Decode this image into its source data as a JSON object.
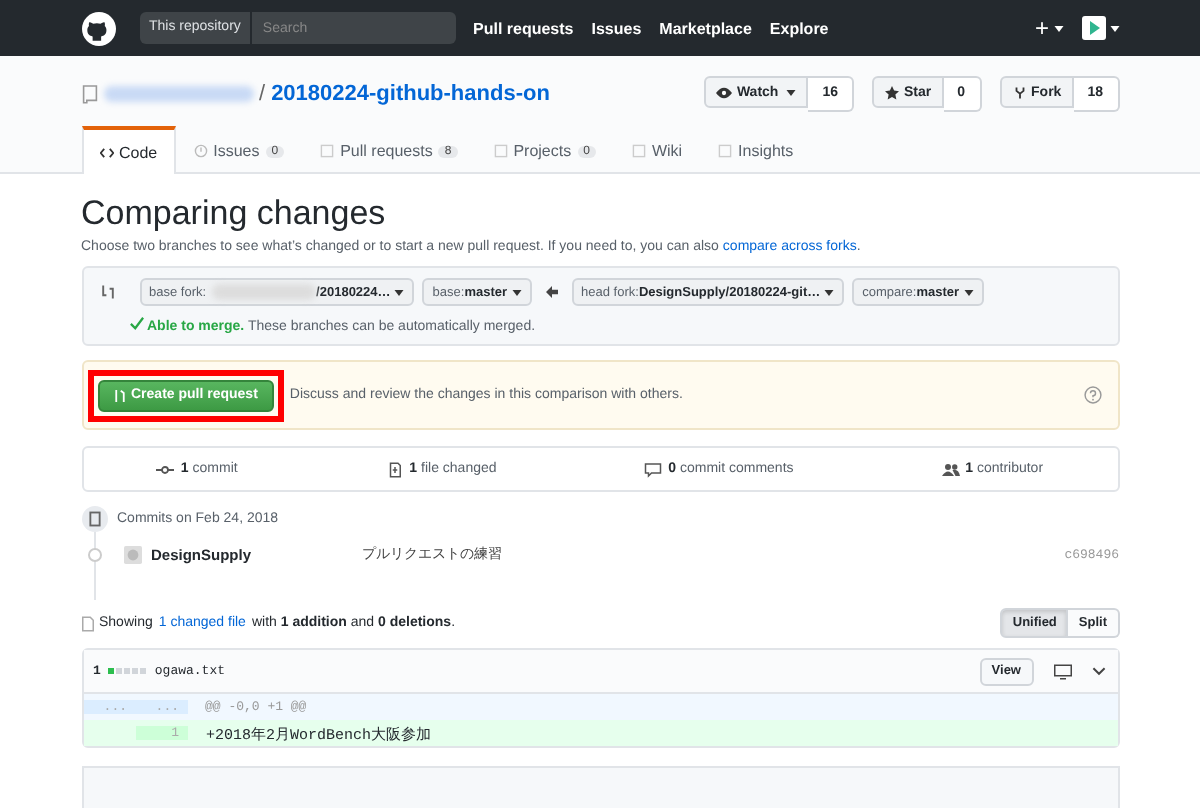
{
  "header": {
    "scope": "This repository",
    "search": {
      "placeholder": "Search"
    },
    "nav": [
      "Pull requests",
      "Issues",
      "Marketplace",
      "Explore"
    ],
    "plus": "+"
  },
  "repo": {
    "separator": "/",
    "name": "20180224-github-hands-on",
    "actions": [
      {
        "kind": "watch",
        "label": "Watch",
        "count": "16"
      },
      {
        "kind": "star",
        "label": "Star",
        "count": "0"
      },
      {
        "kind": "fork",
        "label": "Fork",
        "count": "18"
      }
    ]
  },
  "tabs": [
    {
      "kind": "code",
      "label": "Code",
      "selected": true
    },
    {
      "kind": "issues",
      "label": "Issues",
      "count": "0",
      "selected": false
    },
    {
      "kind": "pulls",
      "label": "Pull requests",
      "count": "8",
      "selected": false
    },
    {
      "kind": "projects",
      "label": "Projects",
      "count": "0",
      "selected": false
    },
    {
      "kind": "wiki",
      "label": "Wiki",
      "selected": false
    },
    {
      "kind": "insights",
      "label": "Insights",
      "selected": false
    }
  ],
  "title": "Comparing changes",
  "description": {
    "text": "Choose two branches to see what’s changed or to start a new pull request. If you need to, you can also",
    "link": "compare across forks",
    "end": "."
  },
  "compare": {
    "selectors": [
      {
        "label": "base fork:",
        "blurred": true,
        "value": "/20180224…"
      },
      {
        "label": "base:",
        "value": "master"
      },
      {
        "label": "head fork:",
        "value": "DesignSupply/20180224-git…"
      },
      {
        "label": "compare:",
        "value": "master"
      }
    ],
    "merge": {
      "ok": true,
      "status": "Able to merge.",
      "text": "These branches can be automatically merged."
    }
  },
  "create": {
    "label": "Create pull request",
    "highlighted": true,
    "text": "Discuss and review the changes in this comparison with others."
  },
  "stats": [
    {
      "kind": "commit",
      "count": "1",
      "label": "commit"
    },
    {
      "kind": "file",
      "count": "1",
      "label": "file changed"
    },
    {
      "kind": "comment",
      "count": "0",
      "label": "commit comments"
    },
    {
      "kind": "people",
      "count": "1",
      "label": "contributor"
    }
  ],
  "commits": {
    "date": "Commits on Feb 24, 2018",
    "items": [
      {
        "author": "DesignSupply",
        "message": "プルリクエストの練習",
        "sha": "c698496"
      }
    ]
  },
  "summary": {
    "prefix": "Showing",
    "link": "1 changed file",
    "rest": "with **1 addition** and **0 deletions**."
  },
  "view_modes": [
    {
      "label": "Unified",
      "selected": true
    },
    {
      "label": "Split",
      "selected": false
    }
  ],
  "file": {
    "changes": "1",
    "diffstat": [
      {
        "kind": "added"
      },
      {
        "kind": "neutral"
      },
      {
        "kind": "neutral"
      },
      {
        "kind": "neutral"
      },
      {
        "kind": "neutral"
      }
    ],
    "name": "ogawa.txt",
    "view": "View",
    "lines": [
      {
        "kind": "hunk",
        "old": "...",
        "new": "...",
        "text": "@@ -0,0 +1 @@"
      },
      {
        "kind": "addition",
        "new": "1",
        "text": "+2018年2月WordBench大阪参加"
      }
    ]
  }
}
